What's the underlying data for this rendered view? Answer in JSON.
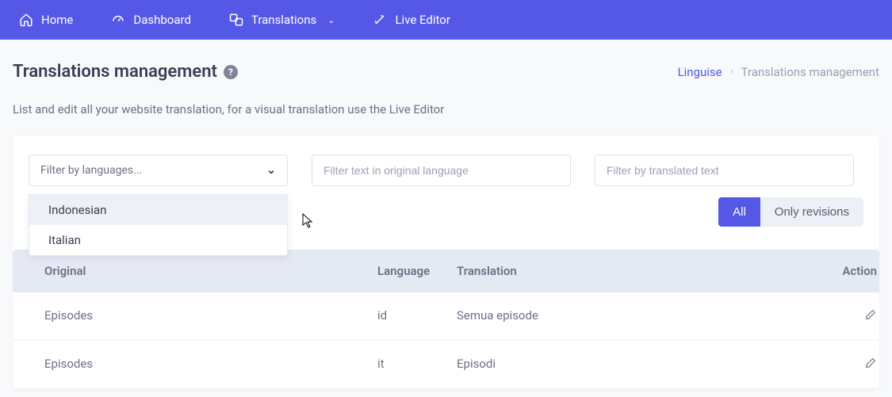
{
  "nav": {
    "home": "Home",
    "dashboard": "Dashboard",
    "translations": "Translations",
    "live_editor": "Live Editor"
  },
  "header": {
    "title": "Translations management",
    "help": "?",
    "crumb_root": "Linguise",
    "crumb_current": "Translations management"
  },
  "subtitle": "List and edit all your website translation, for a visual translation use the Live Editor",
  "filters": {
    "language_placeholder": "Filter by languages...",
    "original_placeholder": "Filter text in original language",
    "translated_placeholder": "Filter by translated text",
    "dropdown": {
      "options": [
        "Indonesian",
        "Italian"
      ]
    }
  },
  "toggle": {
    "all": "All",
    "revisions": "Only revisions"
  },
  "table": {
    "head": {
      "original": "Original",
      "language": "Language",
      "translation": "Translation",
      "action": "Action"
    },
    "rows": [
      {
        "original": "Episodes",
        "language": "id",
        "translation": "Semua episode"
      },
      {
        "original": "Episodes",
        "language": "it",
        "translation": "Episodi"
      }
    ]
  }
}
